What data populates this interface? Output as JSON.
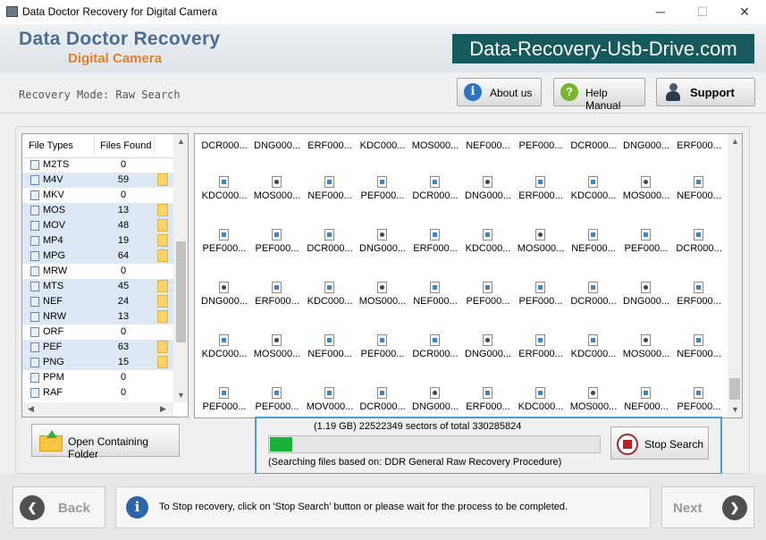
{
  "window": {
    "title": "Data Doctor Recovery for Digital Camera",
    "controls": [
      "─",
      "☐",
      "✕"
    ]
  },
  "header": {
    "brand_line1": "Data Doctor Recovery",
    "brand_line2": "Digital Camera",
    "domain": "Data-Recovery-Usb-Drive.com"
  },
  "subheader": {
    "mode": "Recovery Mode: Raw Search",
    "about_label": "About us",
    "help_label": "Help Manual",
    "support_label": "Support"
  },
  "file_types": {
    "col_type": "File Types",
    "col_found": "Files Found",
    "rows": [
      {
        "name": "M2TS",
        "count": "0",
        "found": false
      },
      {
        "name": "M4V",
        "count": "59",
        "found": true
      },
      {
        "name": "MKV",
        "count": "0",
        "found": false
      },
      {
        "name": "MOS",
        "count": "13",
        "found": true
      },
      {
        "name": "MOV",
        "count": "48",
        "found": true
      },
      {
        "name": "MP4",
        "count": "19",
        "found": true
      },
      {
        "name": "MPG",
        "count": "64",
        "found": true
      },
      {
        "name": "MRW",
        "count": "0",
        "found": false
      },
      {
        "name": "MTS",
        "count": "45",
        "found": true
      },
      {
        "name": "NEF",
        "count": "24",
        "found": true
      },
      {
        "name": "NRW",
        "count": "13",
        "found": true
      },
      {
        "name": "ORF",
        "count": "0",
        "found": false
      },
      {
        "name": "PEF",
        "count": "63",
        "found": true
      },
      {
        "name": "PNG",
        "count": "15",
        "found": true
      },
      {
        "name": "PPM",
        "count": "0",
        "found": false
      },
      {
        "name": "RAF",
        "count": "0",
        "found": false
      }
    ]
  },
  "files": {
    "partial_row": [
      "DCR000...",
      "DNG000...",
      "ERF000...",
      "KDC000...",
      "MOS000...",
      "NEF000...",
      "PEF000...",
      "DCR000...",
      "DNG000...",
      "ERF000..."
    ],
    "rows": [
      [
        "KDC000...",
        "MOS000...",
        "NEF000...",
        "PEF000...",
        "DCR000...",
        "DNG000...",
        "ERF000...",
        "KDC000...",
        "MOS000...",
        "NEF000..."
      ],
      [
        "PEF000...",
        "PEF000...",
        "DCR000...",
        "DNG000...",
        "ERF000...",
        "KDC000...",
        "MOS000...",
        "NEF000...",
        "PEF000...",
        "DCR000..."
      ],
      [
        "DNG000...",
        "ERF000...",
        "KDC000...",
        "MOS000...",
        "NEF000...",
        "PEF000...",
        "PEF000...",
        "DCR000...",
        "DNG000...",
        "ERF000..."
      ],
      [
        "KDC000...",
        "MOS000...",
        "NEF000...",
        "PEF000...",
        "DCR000...",
        "DNG000...",
        "ERF000...",
        "KDC000...",
        "MOS000...",
        "NEF000..."
      ],
      [
        "PEF000...",
        "PEF000...",
        "MOV000...",
        "DCR000...",
        "DNG000...",
        "ERF000...",
        "KDC000...",
        "MOS000...",
        "NEF000...",
        "PEF000..."
      ]
    ]
  },
  "open_folder_label": "Open Containing Folder",
  "progress": {
    "status": "(1.19 GB) 22522349  sectors  of  total 330285824",
    "fraction": 0.068,
    "procedure": "(Searching files based on:  DDR General Raw Recovery Procedure)",
    "stop_label": "Stop Search"
  },
  "footer": {
    "back_label": "Back",
    "next_label": "Next",
    "info_text": "To Stop recovery, click on 'Stop Search' button or please wait for the process to be completed."
  },
  "colors": {
    "accent_blue": "#4c6d92",
    "brand_orange": "#e48227",
    "banner_teal": "#175a5e",
    "progress_green": "#19b13a",
    "row_highlight": "#dde8f5"
  }
}
